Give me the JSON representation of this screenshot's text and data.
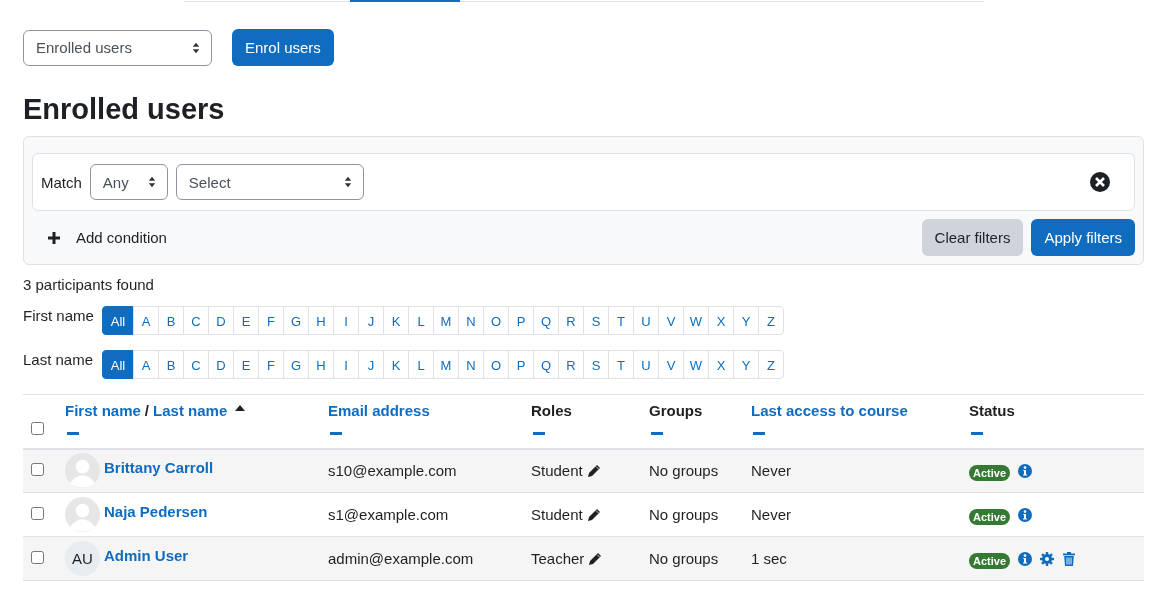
{
  "view_select": {
    "value": "Enrolled users"
  },
  "enrol_button": "Enrol users",
  "heading": "Enrolled users",
  "filter": {
    "match_label": "Match",
    "match_value": "Any",
    "field_value": "Select",
    "add_condition": "Add condition",
    "clear_button": "Clear filters",
    "apply_button": "Apply filters"
  },
  "count": "3 participants found",
  "initial_bars": [
    {
      "label": "First name",
      "letters": [
        {
          "text": "All",
          "selected": true
        },
        {
          "text": "A",
          "selected": false
        },
        {
          "text": "B",
          "selected": false
        },
        {
          "text": "C",
          "selected": false
        },
        {
          "text": "D",
          "selected": false
        },
        {
          "text": "E",
          "selected": false
        },
        {
          "text": "F",
          "selected": false
        },
        {
          "text": "G",
          "selected": false
        },
        {
          "text": "H",
          "selected": false
        },
        {
          "text": "I",
          "selected": false
        },
        {
          "text": "J",
          "selected": false
        },
        {
          "text": "K",
          "selected": false
        },
        {
          "text": "L",
          "selected": false
        },
        {
          "text": "M",
          "selected": false
        },
        {
          "text": "N",
          "selected": false
        },
        {
          "text": "O",
          "selected": false
        },
        {
          "text": "P",
          "selected": false
        },
        {
          "text": "Q",
          "selected": false
        },
        {
          "text": "R",
          "selected": false
        },
        {
          "text": "S",
          "selected": false
        },
        {
          "text": "T",
          "selected": false
        },
        {
          "text": "U",
          "selected": false
        },
        {
          "text": "V",
          "selected": false
        },
        {
          "text": "W",
          "selected": false
        },
        {
          "text": "X",
          "selected": false
        },
        {
          "text": "Y",
          "selected": false
        },
        {
          "text": "Z",
          "selected": false
        }
      ]
    },
    {
      "label": "Last name",
      "letters": [
        {
          "text": "All",
          "selected": true
        },
        {
          "text": "A",
          "selected": false
        },
        {
          "text": "B",
          "selected": false
        },
        {
          "text": "C",
          "selected": false
        },
        {
          "text": "D",
          "selected": false
        },
        {
          "text": "E",
          "selected": false
        },
        {
          "text": "F",
          "selected": false
        },
        {
          "text": "G",
          "selected": false
        },
        {
          "text": "H",
          "selected": false
        },
        {
          "text": "I",
          "selected": false
        },
        {
          "text": "J",
          "selected": false
        },
        {
          "text": "K",
          "selected": false
        },
        {
          "text": "L",
          "selected": false
        },
        {
          "text": "M",
          "selected": false
        },
        {
          "text": "N",
          "selected": false
        },
        {
          "text": "O",
          "selected": false
        },
        {
          "text": "P",
          "selected": false
        },
        {
          "text": "Q",
          "selected": false
        },
        {
          "text": "R",
          "selected": false
        },
        {
          "text": "S",
          "selected": false
        },
        {
          "text": "T",
          "selected": false
        },
        {
          "text": "U",
          "selected": false
        },
        {
          "text": "V",
          "selected": false
        },
        {
          "text": "W",
          "selected": false
        },
        {
          "text": "X",
          "selected": false
        },
        {
          "text": "Y",
          "selected": false
        },
        {
          "text": "Z",
          "selected": false
        }
      ]
    }
  ],
  "table": {
    "select_all": {
      "checked": false
    },
    "columns": [
      {
        "parts": [
          {
            "text": "First name",
            "link": true
          },
          {
            "text": "/",
            "link": false
          },
          {
            "text": "Last name",
            "link": true
          }
        ],
        "sorted": true
      },
      {
        "parts": [
          {
            "text": "Email address",
            "link": true
          }
        ],
        "sorted": false
      },
      {
        "parts": [
          {
            "text": "Roles",
            "link": false
          }
        ],
        "sorted": false
      },
      {
        "parts": [
          {
            "text": "Groups",
            "link": false
          }
        ],
        "sorted": false
      },
      {
        "parts": [
          {
            "text": "Last access to course",
            "link": true
          }
        ],
        "sorted": false
      },
      {
        "parts": [
          {
            "text": "Status",
            "link": false
          }
        ],
        "sorted": false
      }
    ],
    "rows": [
      {
        "checked": false,
        "avatar": {
          "kind": "silhouette"
        },
        "name": "Brittany Carroll",
        "email": "s10@example.com",
        "role": "Student",
        "groups": "No groups",
        "last_access": "Never",
        "status": "Active",
        "actions": [
          {
            "kind": "info"
          }
        ]
      },
      {
        "checked": false,
        "avatar": {
          "kind": "silhouette"
        },
        "name": "Naja Pedersen",
        "email": "s1@example.com",
        "role": "Student",
        "groups": "No groups",
        "last_access": "Never",
        "status": "Active",
        "actions": [
          {
            "kind": "info"
          }
        ]
      },
      {
        "checked": false,
        "avatar": {
          "kind": "initials",
          "text": "AU"
        },
        "name": "Admin User",
        "email": "admin@example.com",
        "role": "Teacher",
        "groups": "No groups",
        "last_access": "1 sec",
        "status": "Active",
        "actions": [
          {
            "kind": "info"
          },
          {
            "kind": "settings"
          },
          {
            "kind": "delete"
          }
        ]
      }
    ]
  }
}
